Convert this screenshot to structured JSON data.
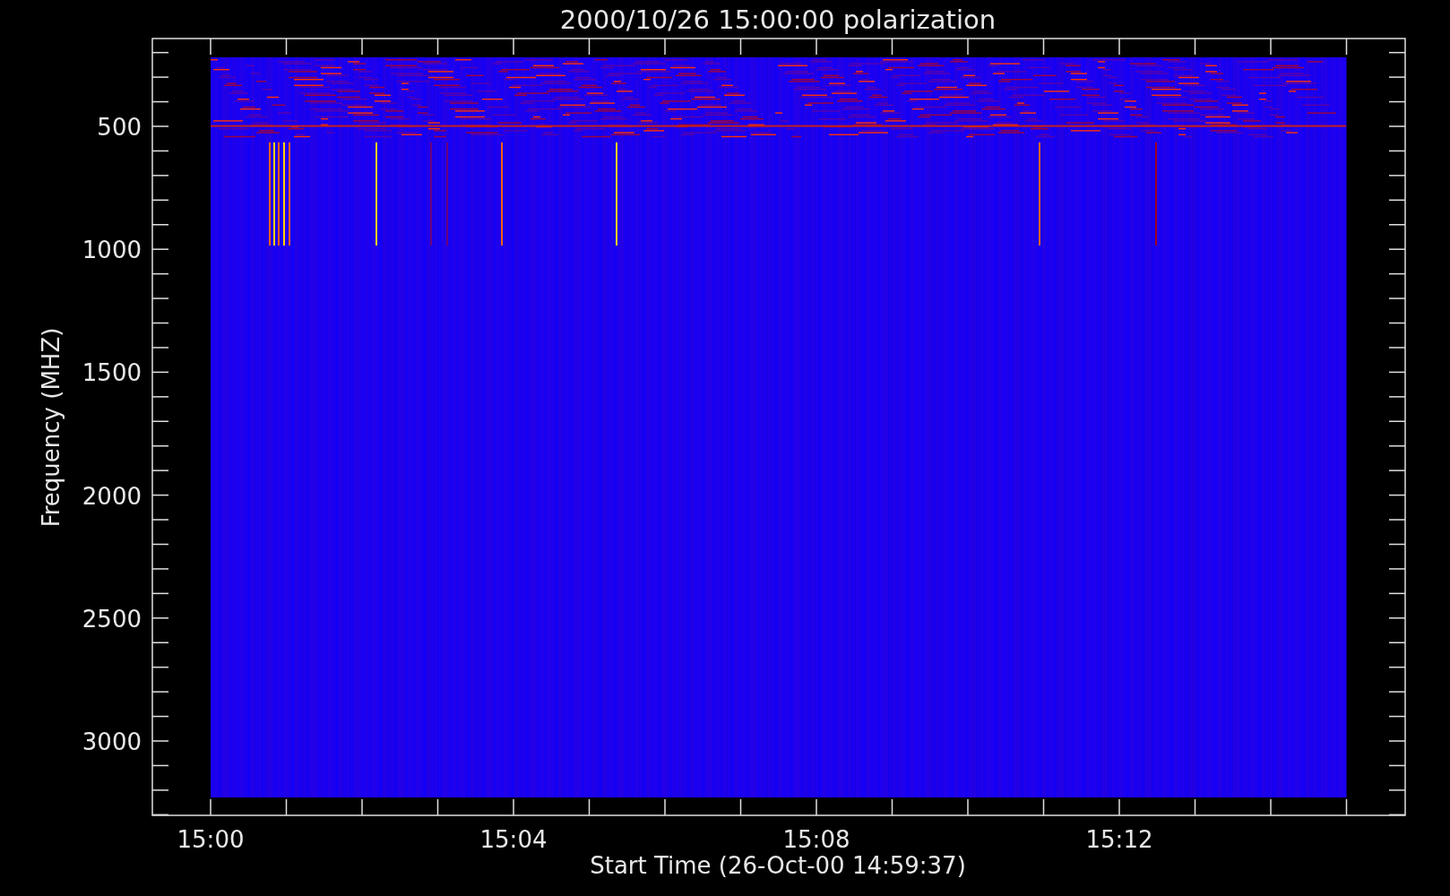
{
  "plot": {
    "title": "2000/10/26 15:00:00 polarization",
    "ylabel": "Frequency (MHZ)",
    "xlabel": "Start Time (26-Oct-00 14:59:37)",
    "y_tick_labels": [
      "500",
      "1000",
      "1500",
      "2000",
      "2500",
      "3000"
    ],
    "x_tick_labels": [
      "15:00",
      "15:04",
      "15:08",
      "15:12"
    ]
  }
}
